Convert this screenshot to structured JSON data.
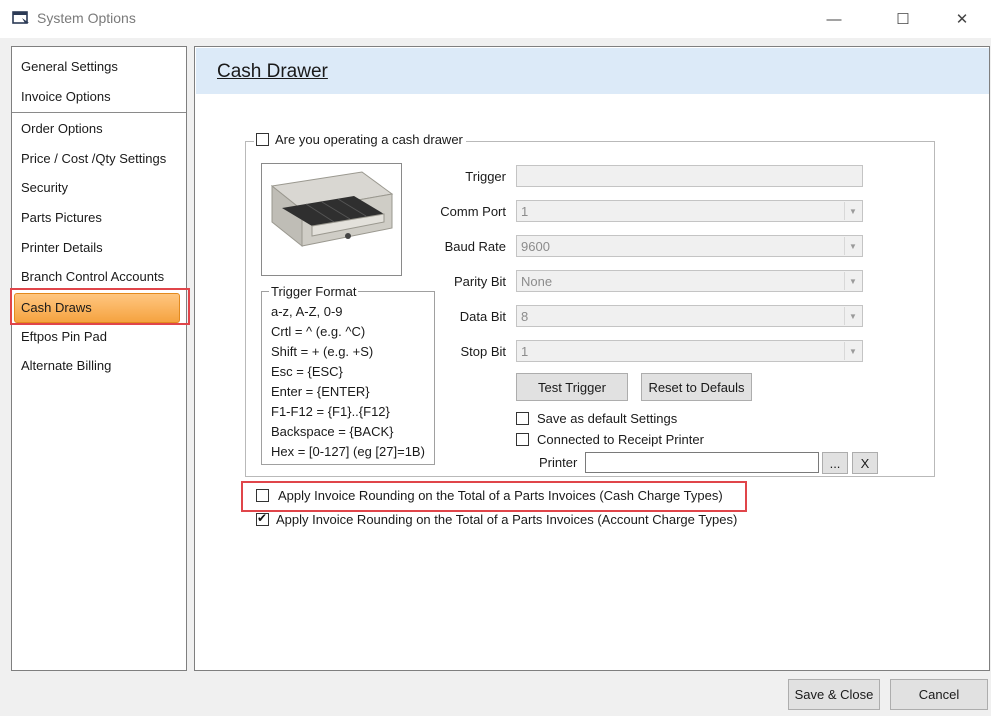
{
  "window": {
    "title": "System Options",
    "minimize_glyph": "—",
    "maximize_glyph": "☐",
    "close_glyph": "✕"
  },
  "sidebar": {
    "items": [
      {
        "label": "General Settings"
      },
      {
        "label": "Invoice Options"
      },
      {
        "label": "Order Options"
      },
      {
        "label": "Price / Cost /Qty Settings"
      },
      {
        "label": "Security"
      },
      {
        "label": "Parts Pictures"
      },
      {
        "label": "Printer Details"
      },
      {
        "label": "Branch Control Accounts"
      },
      {
        "label": "Cash Draws"
      },
      {
        "label": "Eftpos Pin Pad"
      },
      {
        "label": "Alternate Billing"
      }
    ],
    "selected": "Cash Draws"
  },
  "main": {
    "header_title": "Cash Drawer",
    "operating_cash_drawer": {
      "label": "Are you operating a cash drawer",
      "checked": false
    },
    "trigger_format": {
      "title": "Trigger Format",
      "lines": [
        "a-z, A-Z, 0-9",
        "Crtl = ^ (e.g. ^C)",
        "Shift = + (e.g. +S)",
        "Esc = {ESC}",
        "Enter = {ENTER}",
        "F1-F12 =  {F1}..{F12}",
        "Backspace = {BACK}",
        "Hex = [0-127] (eg [27]=1B)"
      ]
    },
    "fields": {
      "trigger": {
        "label": "Trigger",
        "value": ""
      },
      "comm_port": {
        "label": "Comm Port",
        "value": "1"
      },
      "baud_rate": {
        "label": "Baud Rate",
        "value": "9600"
      },
      "parity_bit": {
        "label": "Parity Bit",
        "value": "None"
      },
      "data_bit": {
        "label": "Data Bit",
        "value": "8"
      },
      "stop_bit": {
        "label": "Stop Bit",
        "value": "1"
      }
    },
    "buttons": {
      "test_trigger": "Test Trigger",
      "reset_defaults": "Reset to Defauls",
      "browse": "...",
      "clear": "X"
    },
    "save_default": {
      "label": "Save as default Settings",
      "checked": false
    },
    "connected_receipt": {
      "label": "Connected to Receipt Printer",
      "checked": false
    },
    "printer": {
      "label": "Printer",
      "value": ""
    },
    "rounding_cash": {
      "label": "Apply Invoice Rounding on the Total of a Parts Invoices (Cash Charge Types)",
      "checked": false
    },
    "rounding_account": {
      "label": "Apply Invoice Rounding on the Total of a Parts Invoices (Account Charge Types)",
      "checked": true
    }
  },
  "footer": {
    "save_close": "Save & Close",
    "cancel": "Cancel"
  },
  "colors": {
    "selected_item": "#f5a340",
    "highlight_outline": "#e0454a",
    "header_band": "#dceaf8"
  }
}
